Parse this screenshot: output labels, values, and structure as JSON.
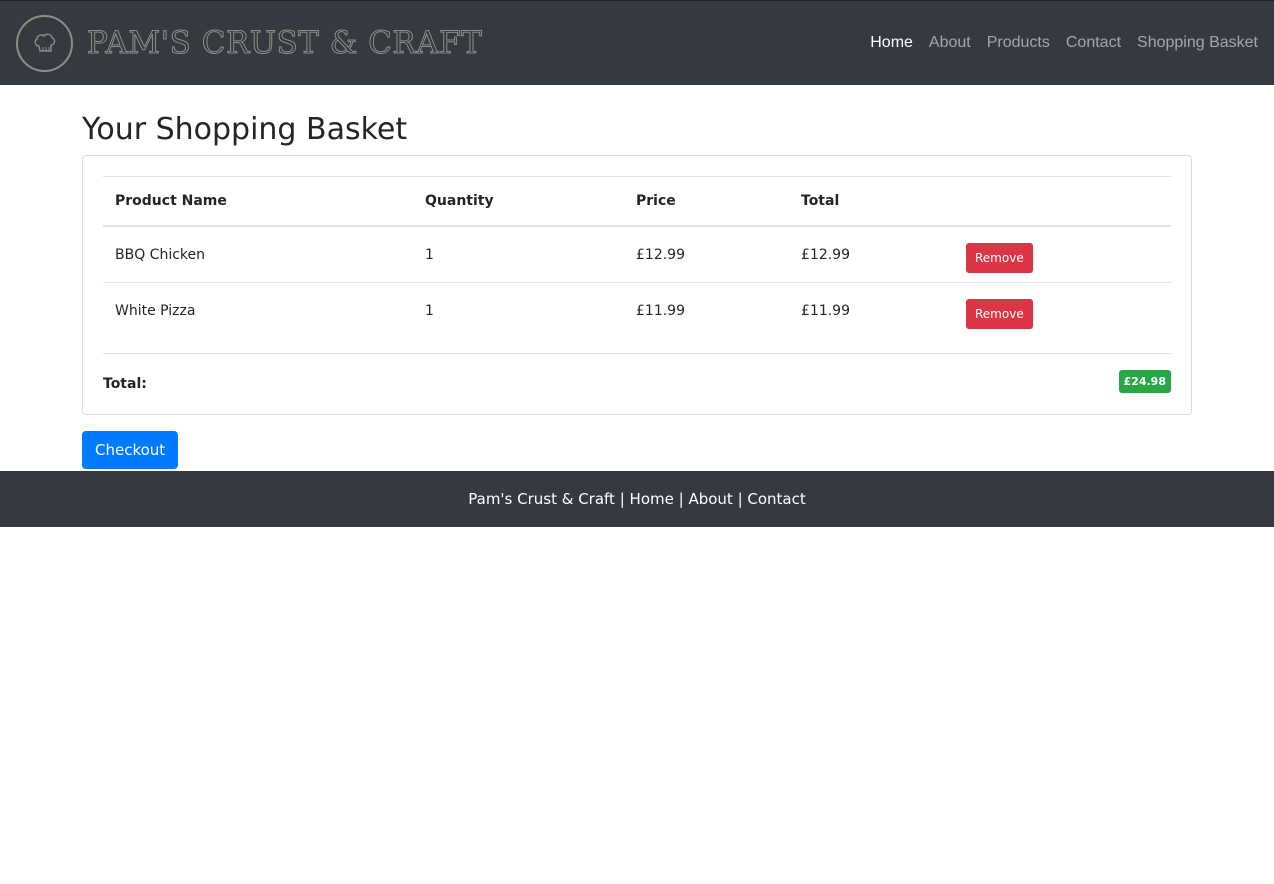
{
  "header": {
    "brand": "PAM'S CRUST & CRAFT",
    "logo_icon": "chef-hat-icon",
    "nav": [
      {
        "label": "Home",
        "active": true
      },
      {
        "label": "About",
        "active": false
      },
      {
        "label": "Products",
        "active": false
      },
      {
        "label": "Contact",
        "active": false
      },
      {
        "label": "Shopping Basket",
        "active": false
      }
    ]
  },
  "main": {
    "title": "Your Shopping Basket",
    "table": {
      "columns": [
        "Product Name",
        "Quantity",
        "Price",
        "Total"
      ],
      "rows": [
        {
          "name": "BBQ Chicken",
          "quantity": "1",
          "price": "£12.99",
          "total": "£12.99",
          "action": "Remove"
        },
        {
          "name": "White Pizza",
          "quantity": "1",
          "price": "£11.99",
          "total": "£11.99",
          "action": "Remove"
        }
      ]
    },
    "total_label": "Total:",
    "total_value": "£24.98",
    "checkout_label": "Checkout"
  },
  "footer": {
    "brand": "Pam's Crust & Craft",
    "separator": " | ",
    "links": [
      "Home",
      "About",
      "Contact"
    ]
  },
  "colors": {
    "navbar": "#343a40",
    "remove": "#dc3545",
    "badge": "#28a745",
    "checkout": "#007bff"
  }
}
